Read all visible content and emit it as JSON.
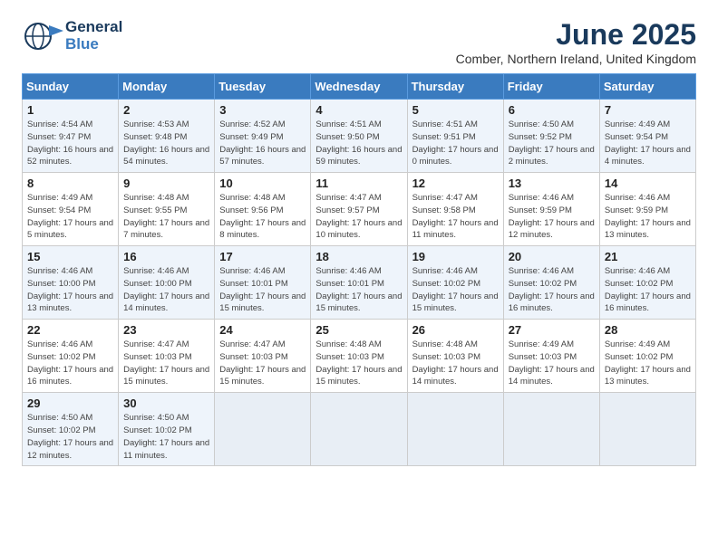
{
  "logo": {
    "line1": "General",
    "line2": "Blue"
  },
  "title": "June 2025",
  "subtitle": "Comber, Northern Ireland, United Kingdom",
  "days": [
    "Sunday",
    "Monday",
    "Tuesday",
    "Wednesday",
    "Thursday",
    "Friday",
    "Saturday"
  ],
  "weeks": [
    [
      {
        "day": "1",
        "sunrise": "4:54 AM",
        "sunset": "9:47 PM",
        "daylight": "16 hours and 52 minutes."
      },
      {
        "day": "2",
        "sunrise": "4:53 AM",
        "sunset": "9:48 PM",
        "daylight": "16 hours and 54 minutes."
      },
      {
        "day": "3",
        "sunrise": "4:52 AM",
        "sunset": "9:49 PM",
        "daylight": "16 hours and 57 minutes."
      },
      {
        "day": "4",
        "sunrise": "4:51 AM",
        "sunset": "9:50 PM",
        "daylight": "16 hours and 59 minutes."
      },
      {
        "day": "5",
        "sunrise": "4:51 AM",
        "sunset": "9:51 PM",
        "daylight": "17 hours and 0 minutes."
      },
      {
        "day": "6",
        "sunrise": "4:50 AM",
        "sunset": "9:52 PM",
        "daylight": "17 hours and 2 minutes."
      },
      {
        "day": "7",
        "sunrise": "4:49 AM",
        "sunset": "9:54 PM",
        "daylight": "17 hours and 4 minutes."
      }
    ],
    [
      {
        "day": "8",
        "sunrise": "4:49 AM",
        "sunset": "9:54 PM",
        "daylight": "17 hours and 5 minutes."
      },
      {
        "day": "9",
        "sunrise": "4:48 AM",
        "sunset": "9:55 PM",
        "daylight": "17 hours and 7 minutes."
      },
      {
        "day": "10",
        "sunrise": "4:48 AM",
        "sunset": "9:56 PM",
        "daylight": "17 hours and 8 minutes."
      },
      {
        "day": "11",
        "sunrise": "4:47 AM",
        "sunset": "9:57 PM",
        "daylight": "17 hours and 10 minutes."
      },
      {
        "day": "12",
        "sunrise": "4:47 AM",
        "sunset": "9:58 PM",
        "daylight": "17 hours and 11 minutes."
      },
      {
        "day": "13",
        "sunrise": "4:46 AM",
        "sunset": "9:59 PM",
        "daylight": "17 hours and 12 minutes."
      },
      {
        "day": "14",
        "sunrise": "4:46 AM",
        "sunset": "9:59 PM",
        "daylight": "17 hours and 13 minutes."
      }
    ],
    [
      {
        "day": "15",
        "sunrise": "4:46 AM",
        "sunset": "10:00 PM",
        "daylight": "17 hours and 13 minutes."
      },
      {
        "day": "16",
        "sunrise": "4:46 AM",
        "sunset": "10:00 PM",
        "daylight": "17 hours and 14 minutes."
      },
      {
        "day": "17",
        "sunrise": "4:46 AM",
        "sunset": "10:01 PM",
        "daylight": "17 hours and 15 minutes."
      },
      {
        "day": "18",
        "sunrise": "4:46 AM",
        "sunset": "10:01 PM",
        "daylight": "17 hours and 15 minutes."
      },
      {
        "day": "19",
        "sunrise": "4:46 AM",
        "sunset": "10:02 PM",
        "daylight": "17 hours and 15 minutes."
      },
      {
        "day": "20",
        "sunrise": "4:46 AM",
        "sunset": "10:02 PM",
        "daylight": "17 hours and 16 minutes."
      },
      {
        "day": "21",
        "sunrise": "4:46 AM",
        "sunset": "10:02 PM",
        "daylight": "17 hours and 16 minutes."
      }
    ],
    [
      {
        "day": "22",
        "sunrise": "4:46 AM",
        "sunset": "10:02 PM",
        "daylight": "17 hours and 16 minutes."
      },
      {
        "day": "23",
        "sunrise": "4:47 AM",
        "sunset": "10:03 PM",
        "daylight": "17 hours and 15 minutes."
      },
      {
        "day": "24",
        "sunrise": "4:47 AM",
        "sunset": "10:03 PM",
        "daylight": "17 hours and 15 minutes."
      },
      {
        "day": "25",
        "sunrise": "4:48 AM",
        "sunset": "10:03 PM",
        "daylight": "17 hours and 15 minutes."
      },
      {
        "day": "26",
        "sunrise": "4:48 AM",
        "sunset": "10:03 PM",
        "daylight": "17 hours and 14 minutes."
      },
      {
        "day": "27",
        "sunrise": "4:49 AM",
        "sunset": "10:03 PM",
        "daylight": "17 hours and 14 minutes."
      },
      {
        "day": "28",
        "sunrise": "4:49 AM",
        "sunset": "10:02 PM",
        "daylight": "17 hours and 13 minutes."
      }
    ],
    [
      {
        "day": "29",
        "sunrise": "4:50 AM",
        "sunset": "10:02 PM",
        "daylight": "17 hours and 12 minutes."
      },
      {
        "day": "30",
        "sunrise": "4:50 AM",
        "sunset": "10:02 PM",
        "daylight": "17 hours and 11 minutes."
      },
      null,
      null,
      null,
      null,
      null
    ]
  ]
}
